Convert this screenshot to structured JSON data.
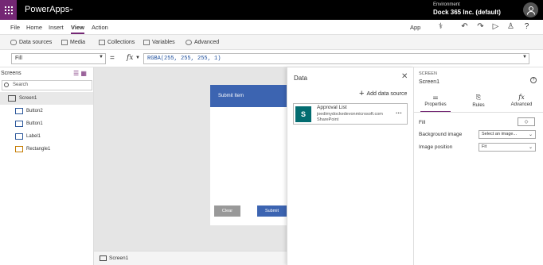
{
  "app": {
    "title": "PowerApps"
  },
  "environment": {
    "label": "Environment",
    "name": "Dock 365 Inc. (default)"
  },
  "menu": {
    "items": [
      "File",
      "Home",
      "Insert",
      "View",
      "Action"
    ],
    "active": "View",
    "app_label": "App"
  },
  "ribbon": {
    "items": [
      "Data sources",
      "Media",
      "Collections",
      "Variables",
      "Advanced"
    ]
  },
  "formula": {
    "property": "Fill",
    "fx": "fx",
    "value": "RGBA(255, 255, 255, 1)"
  },
  "screens_panel": {
    "title": "Screens",
    "search_placeholder": "Search",
    "tree": [
      {
        "label": "Screen1",
        "selected": true,
        "level": 0
      },
      {
        "label": "Button2",
        "selected": false,
        "level": 1
      },
      {
        "label": "Button1",
        "selected": false,
        "level": 1
      },
      {
        "label": "Label1",
        "selected": false,
        "level": 1
      },
      {
        "label": "Rectangle1",
        "selected": false,
        "level": 1
      }
    ]
  },
  "canvas": {
    "header": "Submit Item",
    "clear_button": "Clear",
    "submit_button": "Submit"
  },
  "statusbar": {
    "screen": "Screen1"
  },
  "data_panel": {
    "title": "Data",
    "add_label": "Add data source",
    "source": {
      "title": "Approval List",
      "url": "joedimydockedevonmicrosoft.com",
      "type": "SharePoint",
      "logo": "S"
    }
  },
  "properties_panel": {
    "type_label": "SCREEN",
    "name": "Screen1",
    "tabs": [
      "Properties",
      "Rules",
      "Advanced"
    ],
    "fill_label": "Fill",
    "bg_image_label": "Background image",
    "bg_image_value": "Select an image...",
    "image_position_label": "Image position",
    "image_position_value": "Fit"
  },
  "colors": {
    "brand": "#742774",
    "accent": "#3c64b1",
    "sharepoint": "#036c70"
  }
}
